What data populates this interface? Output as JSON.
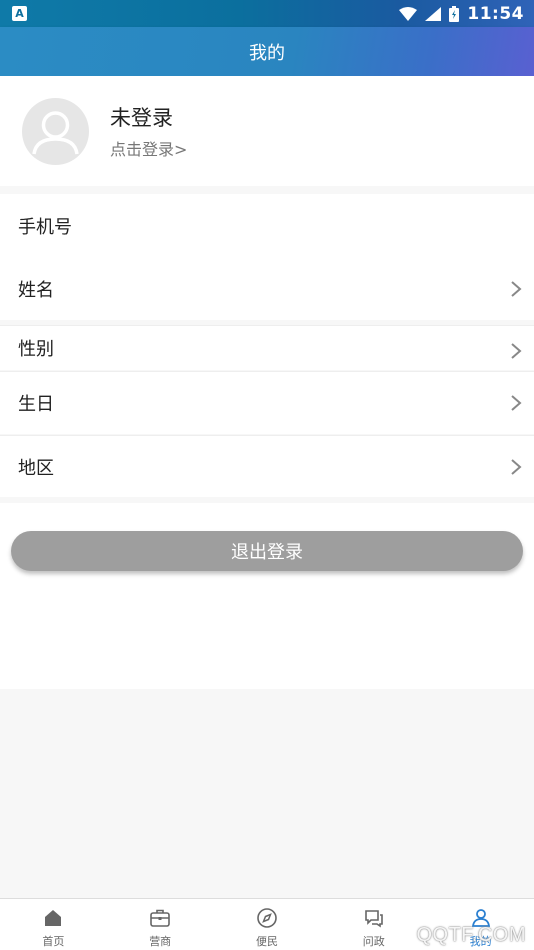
{
  "status_bar": {
    "app_badge": "A",
    "time": "11:54"
  },
  "header": {
    "title": "我的"
  },
  "profile": {
    "name": "未登录",
    "login_link": "点击登录>"
  },
  "fields": [
    {
      "label": "手机号"
    },
    {
      "label": "姓名"
    },
    {
      "label": "性别"
    },
    {
      "label": "生日"
    },
    {
      "label": "地区"
    }
  ],
  "logout": {
    "label": "退出登录"
  },
  "tabs": [
    {
      "label": "首页",
      "icon": "home-icon"
    },
    {
      "label": "营商",
      "icon": "briefcase-icon"
    },
    {
      "label": "便民",
      "icon": "compass-icon"
    },
    {
      "label": "问政",
      "icon": "chat-icon"
    },
    {
      "label": "我的",
      "icon": "user-icon"
    }
  ],
  "watermark": "QQTF.COM",
  "colors": {
    "accent": "#2a7fd0",
    "header": "#2b8cc4",
    "logout_bg": "#9e9e9e"
  }
}
